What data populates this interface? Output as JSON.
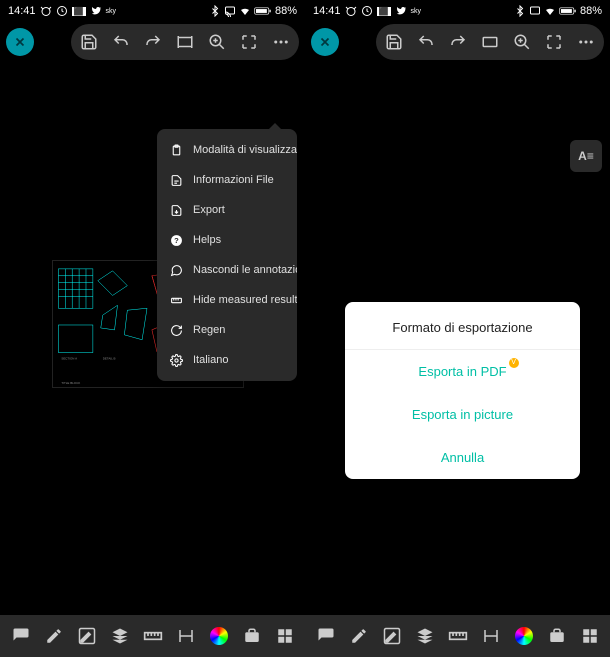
{
  "status": {
    "time": "14:41",
    "battery": "88%"
  },
  "menu": {
    "items": [
      {
        "label": "Modalità di visualizza…",
        "icon": "clipboard"
      },
      {
        "label": "Informazioni File",
        "icon": "doc"
      },
      {
        "label": "Export",
        "icon": "export"
      },
      {
        "label": "Helps",
        "icon": "help"
      },
      {
        "label": "Nascondi le annotazioni",
        "icon": "annotation"
      },
      {
        "label": "Hide measured result",
        "icon": "measure"
      },
      {
        "label": "Regen",
        "icon": "regen"
      },
      {
        "label": "Italiano",
        "icon": "settings"
      }
    ]
  },
  "modal": {
    "title": "Formato di esportazione",
    "option_pdf": "Esporta in PDF",
    "option_picture": "Esporta in picture",
    "cancel": "Annulla"
  },
  "float_label": "A≡"
}
